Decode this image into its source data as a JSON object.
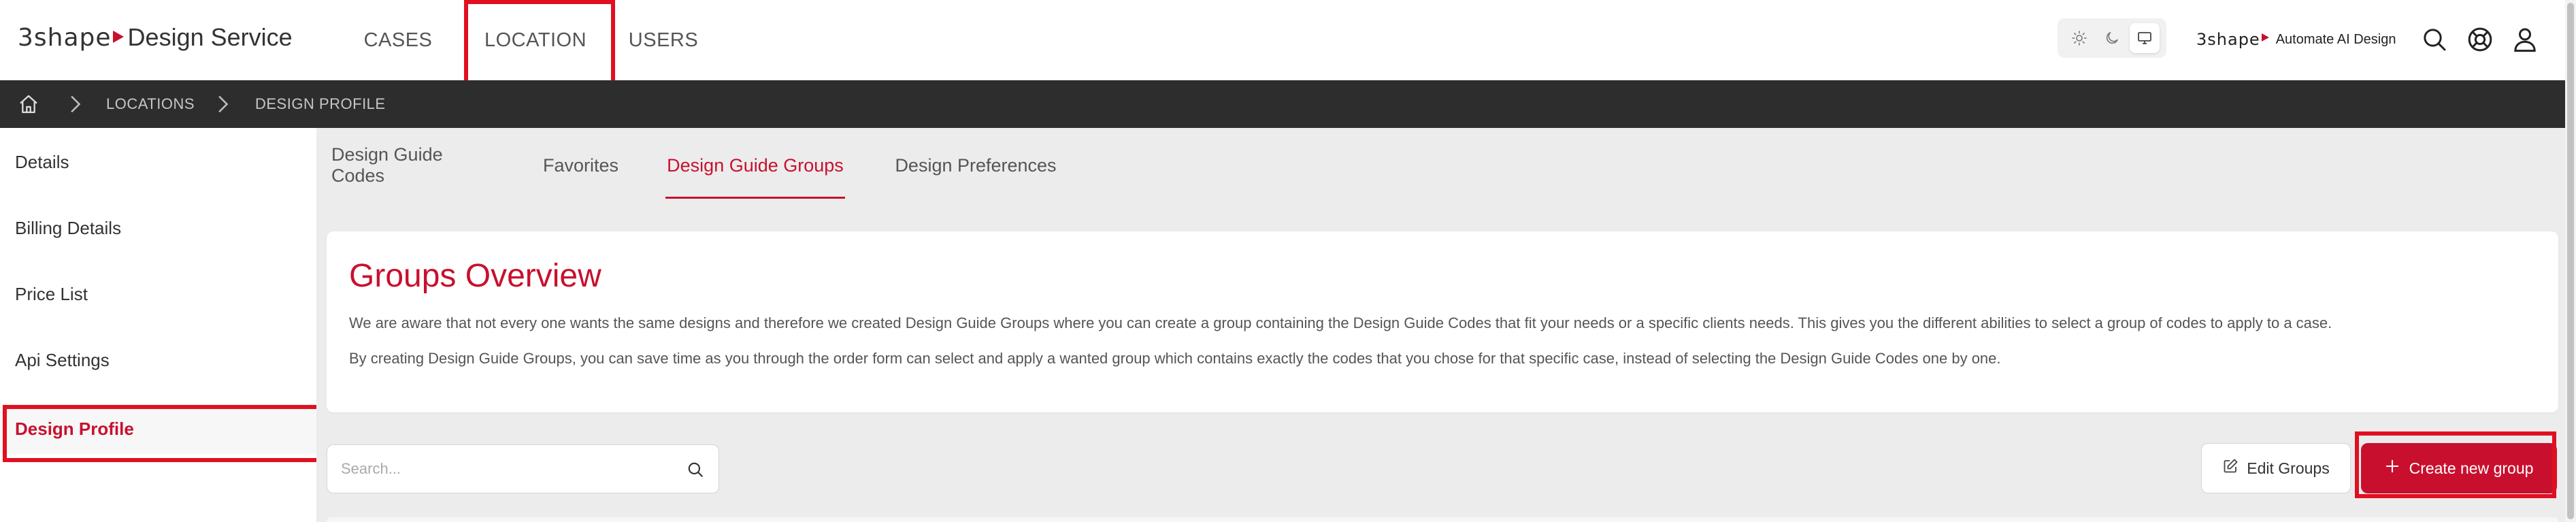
{
  "brand": {
    "mark": "3shape",
    "name": "Design Service"
  },
  "nav": {
    "cases": "CASES",
    "location": "LOCATION",
    "users": "USERS"
  },
  "header": {
    "ai_mark": "3shape",
    "ai_name": "Automate AI Design"
  },
  "icons": {
    "theme_light": "sun-icon",
    "theme_dark": "moon-icon",
    "theme_system": "monitor-icon",
    "search": "search-icon",
    "help": "lifebuoy-icon",
    "user": "user-icon",
    "home": "home-icon",
    "edit": "pencil-icon",
    "add": "plus-icon"
  },
  "breadcrumb": {
    "items": [
      "LOCATIONS",
      "DESIGN PROFILE"
    ]
  },
  "sidebar": {
    "items": [
      {
        "label": "Details"
      },
      {
        "label": "Billing Details"
      },
      {
        "label": "Price List"
      },
      {
        "label": "Api Settings"
      },
      {
        "label": "Design Profile"
      }
    ],
    "active": "Design Profile"
  },
  "subtabs": {
    "items": [
      {
        "label": "Design Guide Codes"
      },
      {
        "label": "Favorites"
      },
      {
        "label": "Design Guide Groups"
      },
      {
        "label": "Design Preferences"
      }
    ],
    "active": "Design Guide Groups"
  },
  "overview": {
    "title": "Groups Overview",
    "paragraph1": "We are aware that not every one wants the same designs and therefore we created Design Guide Groups where you can create a group containing the Design Guide Codes that fit your needs or a specific clients needs. This gives you the different abilities to select a group of codes to apply to a case.",
    "paragraph2": "By creating Design Guide Groups, you can save time as you through the order form can select and apply a wanted group which contains exactly the codes that you chose for that specific case, instead of selecting the Design Guide Codes one by one."
  },
  "search": {
    "placeholder": "Search...",
    "value": ""
  },
  "actions": {
    "edit_label": "Edit Groups",
    "create_label": "Create new group"
  },
  "colors": {
    "accent": "#c8102e",
    "highlight": "#e01020",
    "breadcrumb_bg": "#2d2d2d",
    "content_bg": "#ececec"
  }
}
